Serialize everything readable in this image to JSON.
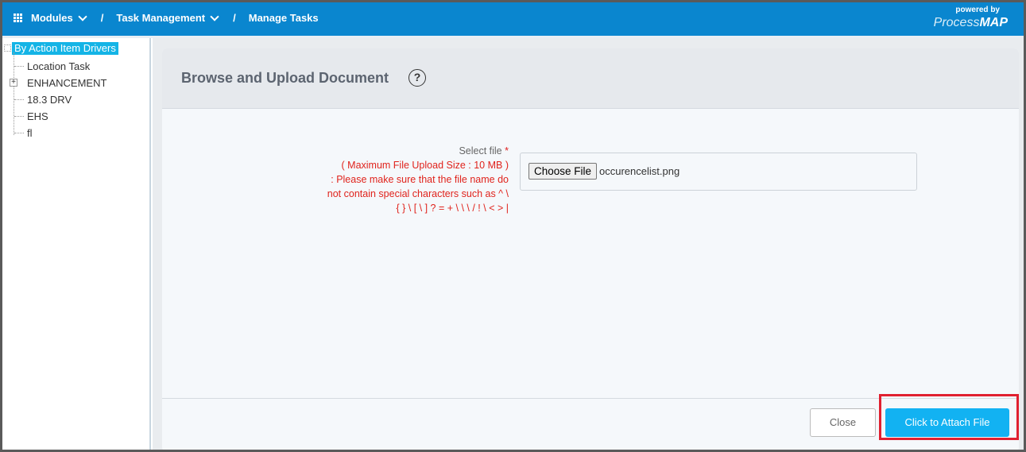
{
  "nav": {
    "modules": "Modules",
    "separator": "/",
    "task_management": "Task Management",
    "manage_tasks": "Manage Tasks"
  },
  "brand": {
    "powered_by": "powered by",
    "process": "Process",
    "map": "MAP"
  },
  "tree": {
    "root": "By Action Item Drivers",
    "items": [
      "Location Task",
      "ENHANCEMENT",
      "18.3 DRV",
      "EHS",
      "fl"
    ]
  },
  "dialog": {
    "title": "Browse and Upload Document",
    "help": "?",
    "select_label": "Select file",
    "required_mark": "*",
    "max_size_note": "( Maximum File Upload Size : 10 MB )",
    "name_note_1": ": Please make sure that the file name do",
    "name_note_2": "not contain special characters such as ^ \\",
    "name_note_3": "{ } \\ [ \\ ] ? = + \\ \\ \\ / ! \\ < > |",
    "choose_file": "Choose File",
    "file_name": "occurencelist.png",
    "close_button": "Close",
    "attach_button": "Click to Attach File"
  },
  "colors": {
    "topbar": "#0a86cf",
    "tree_selected": "#14b4e6",
    "attach_button": "#12b2f2",
    "highlight": "#e02030",
    "warning_text": "#e0231c"
  }
}
